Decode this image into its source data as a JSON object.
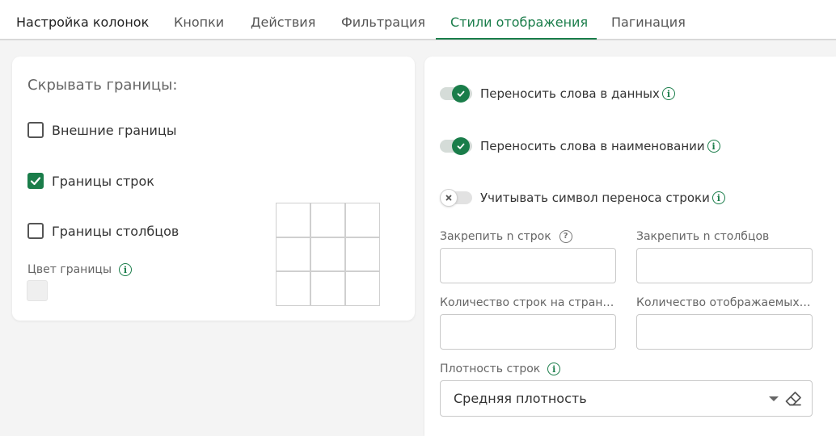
{
  "tabs": [
    {
      "label": "Настройка колонок"
    },
    {
      "label": "Кнопки"
    },
    {
      "label": "Действия"
    },
    {
      "label": "Фильтрация"
    },
    {
      "label": "Стили отображения",
      "active": true
    },
    {
      "label": "Пагинация"
    }
  ],
  "borders": {
    "title": "Скрывать границы:",
    "options": [
      {
        "label": "Внешние границы",
        "checked": false
      },
      {
        "label": "Границы строк",
        "checked": true
      },
      {
        "label": "Границы столбцов",
        "checked": false
      }
    ],
    "color_label": "Цвет границы",
    "color_value": "#efefef"
  },
  "wrapping": {
    "toggles": [
      {
        "label": "Переносить слова в данных",
        "on": true
      },
      {
        "label": "Переносить слова в наименовании",
        "on": true
      },
      {
        "label": "Учитывать символ переноса строки",
        "on": false
      }
    ]
  },
  "fields": {
    "freeze_rows": {
      "label": "Закрепить n строк",
      "value": ""
    },
    "freeze_cols": {
      "label": "Закрепить n столбцов",
      "value": ""
    },
    "rows_per_page": {
      "label": "Количество строк на страни...",
      "value": ""
    },
    "displayed_count": {
      "label": "Количество отображаемых ...",
      "value": ""
    }
  },
  "density": {
    "label": "Плотность строк",
    "value": "Средняя плотность"
  },
  "colors": {
    "accent": "#1a7d4a",
    "background": "#f4f4f4",
    "card": "#ffffff"
  }
}
